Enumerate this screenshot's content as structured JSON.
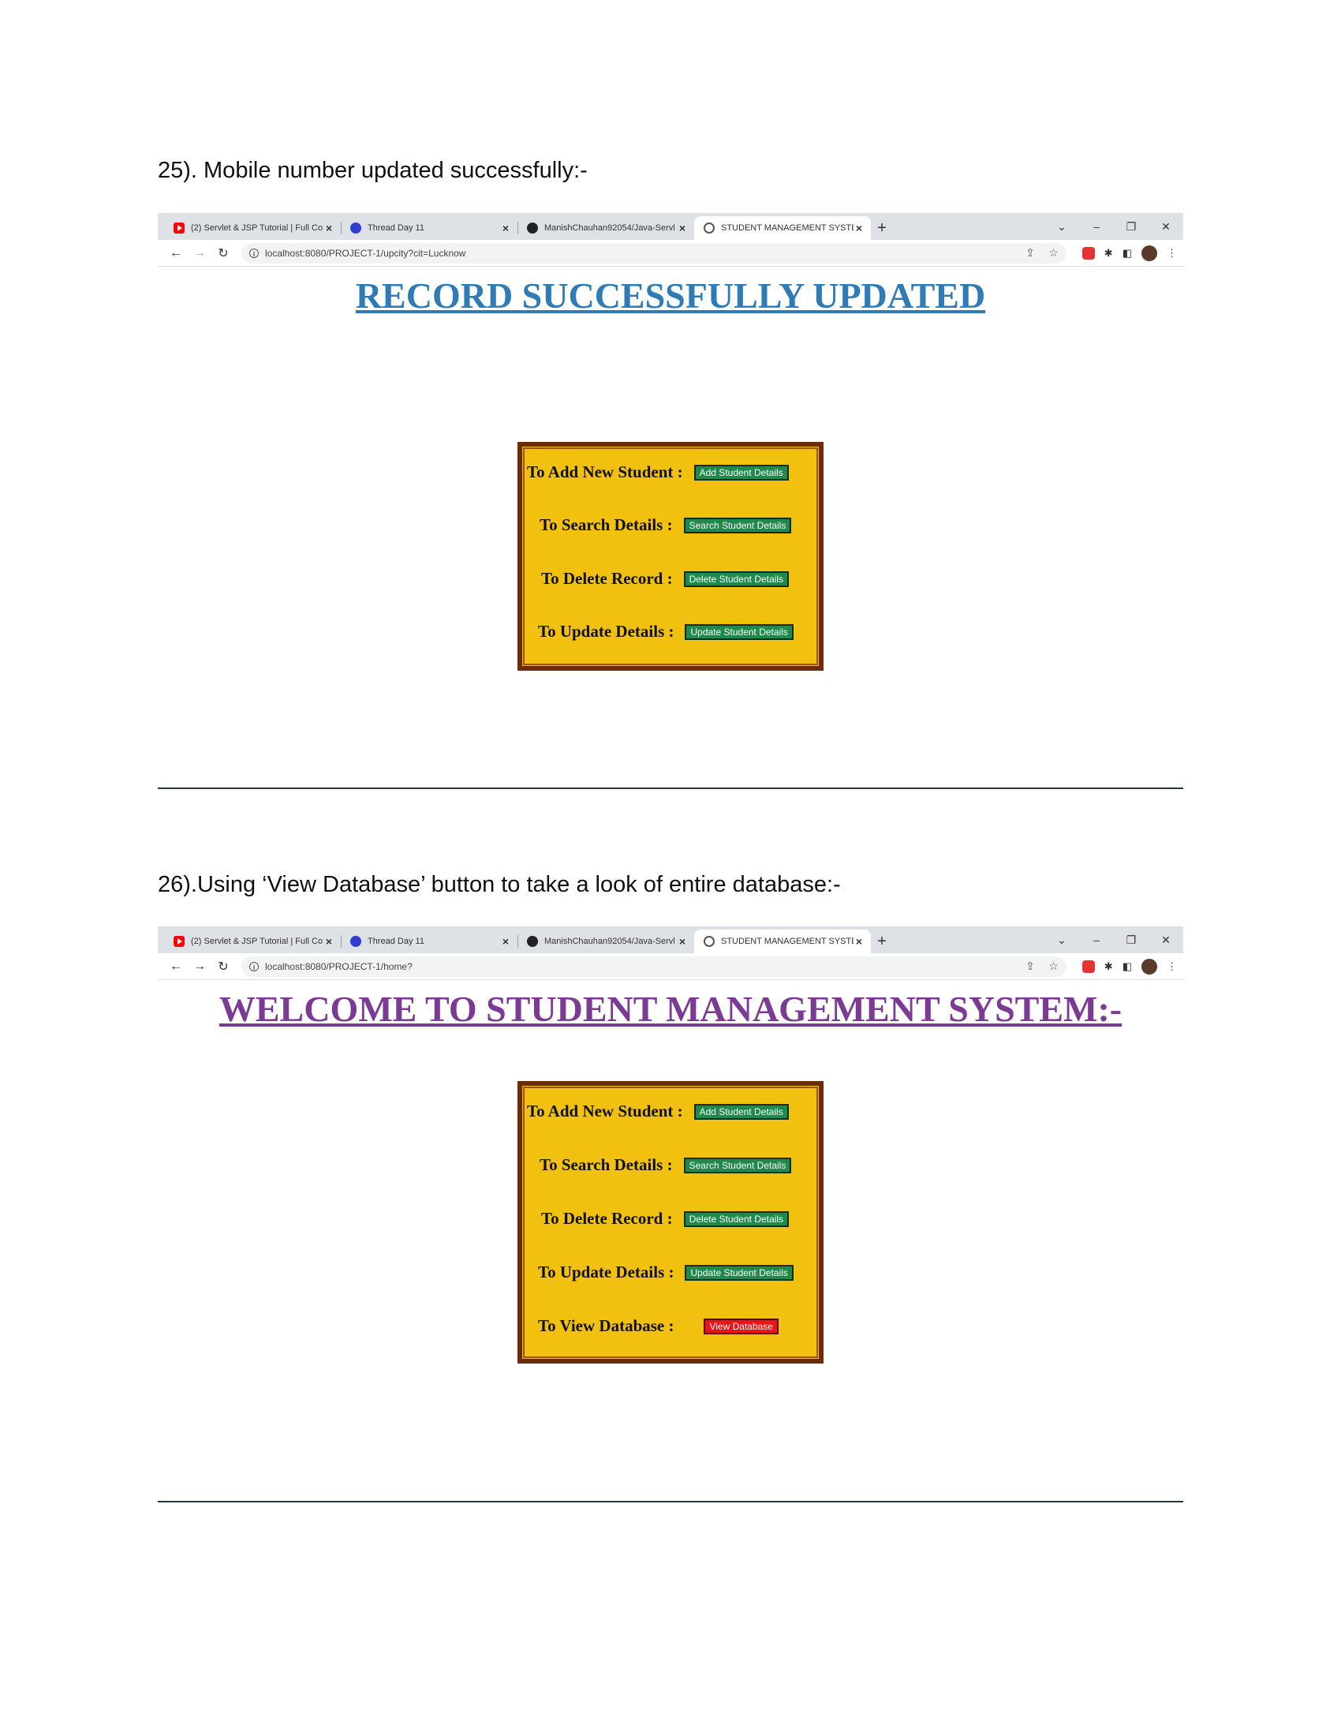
{
  "section1": {
    "caption": "25). Mobile number updated successfully:-",
    "browser": {
      "tabs": [
        {
          "title": "(2) Servlet & JSP Tutorial | Full Co",
          "icon": "youtube-icon"
        },
        {
          "title": "Thread Day 11",
          "icon": "gfg-icon"
        },
        {
          "title": "ManishChauhan92054/Java-Servl",
          "icon": "github-icon"
        },
        {
          "title": "STUDENT MANAGEMENT SYSTEM",
          "icon": "globe-icon"
        }
      ],
      "close_glyph": "×",
      "newtab_glyph": "+",
      "url": "localhost:8080/PROJECT-1/upcity?cit=Lucknow"
    },
    "heading": "RECORD SUCCESSFULLY UPDATED",
    "menu": [
      {
        "label": "To Add New Student :",
        "button": "Add Student Details"
      },
      {
        "label": "To Search Details :",
        "button": "Search Student Details"
      },
      {
        "label": "To Delete Record :",
        "button": "Delete Student Details"
      },
      {
        "label": "To Update Details :",
        "button": "Update Student Details"
      }
    ]
  },
  "section2": {
    "caption": "26).Using ‘View Database’ button to take a look of entire database:-",
    "browser": {
      "tabs": [
        {
          "title": "(2) Servlet & JSP Tutorial | Full Co",
          "icon": "youtube-icon"
        },
        {
          "title": "Thread Day 11",
          "icon": "gfg-icon"
        },
        {
          "title": "ManishChauhan92054/Java-Servl",
          "icon": "github-icon"
        },
        {
          "title": "STUDENT MANAGEMENT SYSTEM",
          "icon": "globe-icon"
        }
      ],
      "close_glyph": "×",
      "newtab_glyph": "+",
      "url": "localhost:8080/PROJECT-1/home?"
    },
    "heading": "WELCOME TO STUDENT MANAGEMENT SYSTEM:-",
    "menu": [
      {
        "label": "To Add New Student :",
        "button": "Add Student Details"
      },
      {
        "label": "To Search Details :",
        "button": "Search Student Details"
      },
      {
        "label": "To Delete Record :",
        "button": "Delete Student Details"
      },
      {
        "label": "To Update Details :",
        "button": "Update Student Details"
      },
      {
        "label": "To View Database :",
        "button": "View Database"
      }
    ]
  },
  "colors": {
    "heading_blue": "#2e7bb6",
    "heading_purple": "#7b3b95",
    "menu_background": "#f2c10f",
    "menu_border": "#6b2d05",
    "button_green": "#1f8a4c",
    "button_red": "#e8161b"
  }
}
